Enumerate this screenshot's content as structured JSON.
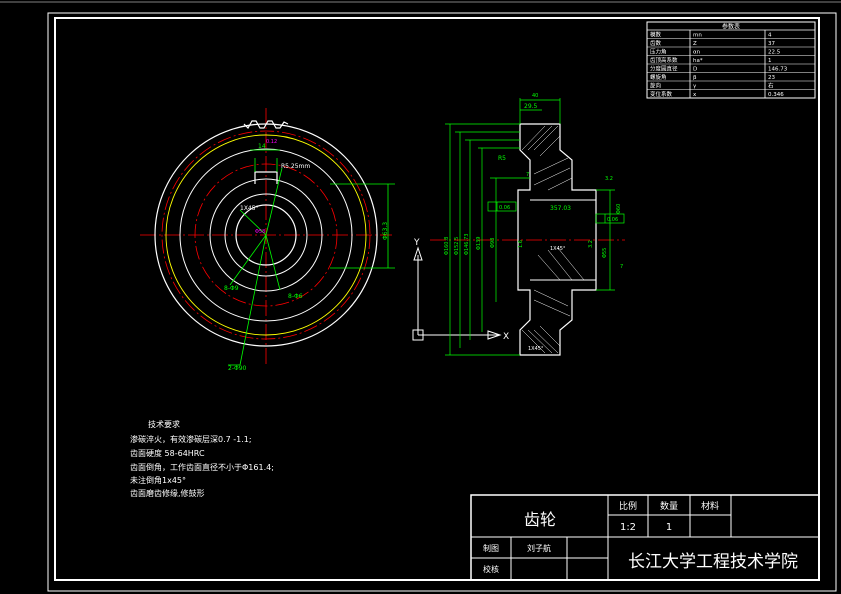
{
  "colors": {
    "background": "#000000",
    "frame": "#ffffff",
    "dimension": "#00ff00",
    "centerline": "#ff0000",
    "highlight": "#ff00ff",
    "addendum": "#ffff00",
    "axis": "#ffffff"
  },
  "params_table": {
    "title": "参数表",
    "rows": [
      {
        "name": "模数",
        "symbol": "mn",
        "value": "4"
      },
      {
        "name": "齿数",
        "symbol": "Z",
        "value": "37"
      },
      {
        "name": "压力角",
        "symbol": "αn",
        "value": "22.5"
      },
      {
        "name": "齿顶高系数",
        "symbol": "ha*",
        "value": "1"
      },
      {
        "name": "分度圆直径",
        "symbol": "D",
        "value": "146.73"
      },
      {
        "name": "螺旋角",
        "symbol": "β",
        "value": "23"
      },
      {
        "name": "旋向",
        "symbol": "γ",
        "value": "右"
      },
      {
        "name": "变位系数",
        "symbol": "x",
        "value": "0.346"
      }
    ]
  },
  "front_view": {
    "labels": {
      "key_width": "14",
      "tol": "0.12",
      "radius": "R5.25mm",
      "chamfer": "1X45°",
      "bore": "Φ58",
      "dim_right": "Φ63.3",
      "r1": "8-Φ9",
      "r2": "8-Φ6",
      "r3": "2-Φ90"
    }
  },
  "section_view": {
    "labels": {
      "width_top": "40",
      "hub_width": "29.5",
      "d1": "Φ160.8",
      "d2": "Φ152.5",
      "d3": "Φ146.73",
      "d4": "Φ139",
      "d5": "Φ98",
      "r5": "R5",
      "bore_tol": "357.03",
      "chamfer": "1X45°",
      "chamfer_bottom": "1X45°",
      "dim_a": "0.06",
      "dim_b": "0.06",
      "dim_c": "Φ60",
      "dim_d": "Φ55",
      "roughness_1": "7",
      "roughness_2": "1.6",
      "roughness_3": "3.2",
      "roughness_4": "3.2",
      "roughness_5": "7"
    }
  },
  "axes": {
    "x": "X",
    "y": "Y"
  },
  "tech_req": {
    "title": "技术要求",
    "lines": [
      "渗碳淬火，有效渗碳层深0.7 -1.1;",
      "齿面硬度 58-64HRC",
      "齿面倒角，工作齿面直径不小于Φ161.4;",
      "未注倒角1x45°",
      "齿面磨齿修缘,修鼓形"
    ]
  },
  "title_block": {
    "part_name": "齿轮",
    "scale_label": "比例",
    "quantity_label": "数量",
    "material_label": "材料",
    "scale_value": "1:2",
    "quantity_value": "1",
    "material_value": "",
    "drawn_label": "制图",
    "drawn_value": "刘子航",
    "checked_label": "校核",
    "checked_value": "",
    "school": "长江大学工程技术学院"
  }
}
